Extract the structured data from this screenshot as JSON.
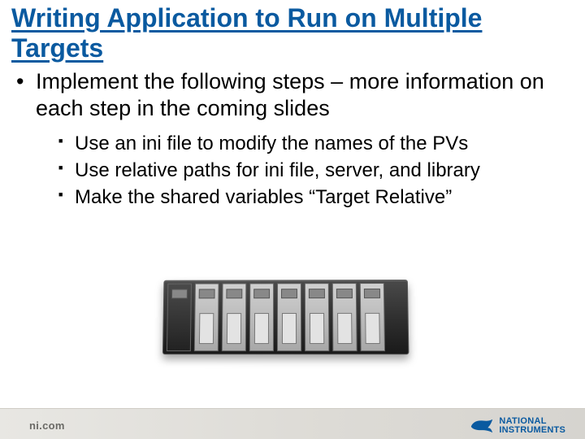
{
  "title": "Writing Application to Run on Multiple Targets",
  "main_bullet": "Implement the following steps – more information on each step in the coming slides",
  "sub_bullets": [
    "Use an ini file to modify the names of the PVs",
    "Use relative paths for ini file, server, and library",
    "Make the shared variables “Target Relative”"
  ],
  "footer": {
    "url": "ni.com",
    "logo_line1": "NATIONAL",
    "logo_line2": "INSTRUMENTS"
  }
}
